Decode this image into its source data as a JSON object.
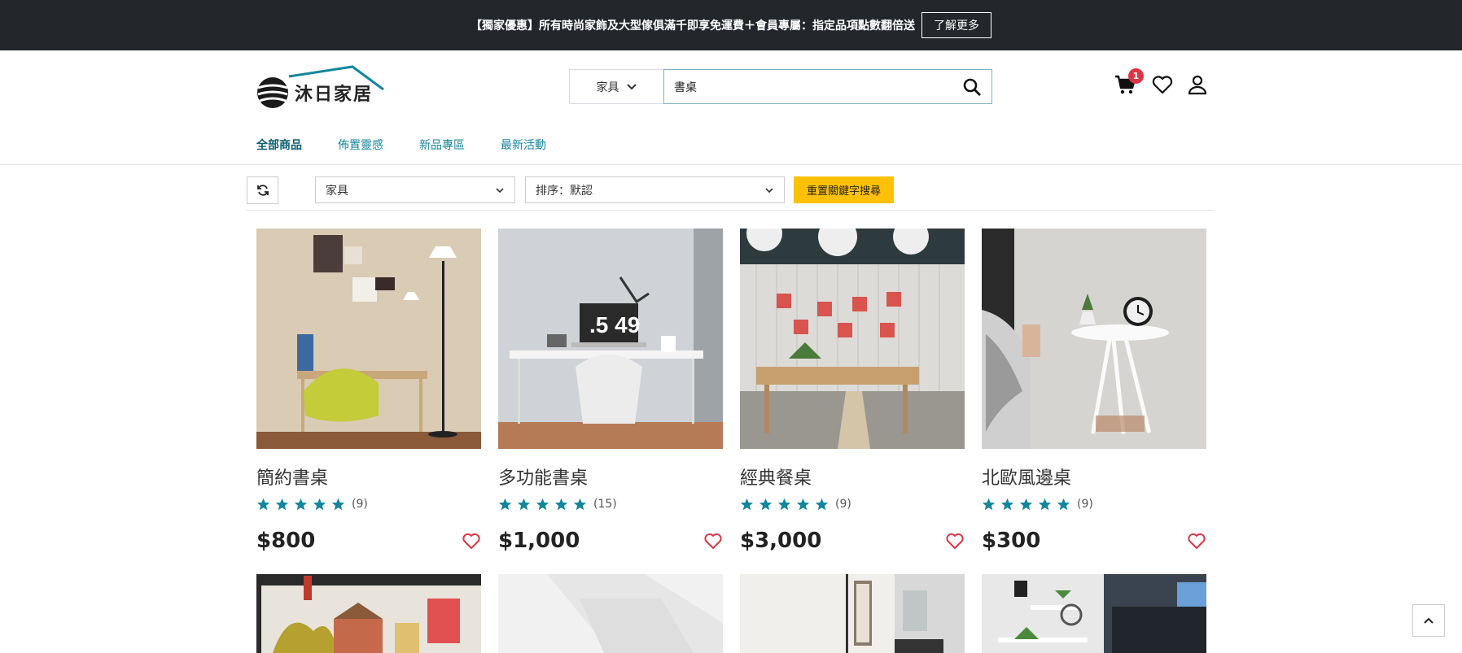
{
  "promo": {
    "text": "【獨家優惠】所有時尚家飾及大型傢俱滿千即享免運費＋會員專屬：指定品項點數翻倍送",
    "button": "了解更多"
  },
  "brand": {
    "name": "沐日家居"
  },
  "search": {
    "category": "家具",
    "value": "書桌"
  },
  "cart": {
    "badge": "1"
  },
  "nav": {
    "items": [
      {
        "label": "全部商品"
      },
      {
        "label": "佈置靈感"
      },
      {
        "label": "新品專區"
      },
      {
        "label": "最新活動"
      }
    ]
  },
  "filters": {
    "category": "家具",
    "sort": "排序：默認",
    "reset": "重置關鍵字搜尋"
  },
  "products": [
    {
      "title": "簡約書桌",
      "rating": 5,
      "count": "(9)",
      "price": "$800"
    },
    {
      "title": "多功能書桌",
      "rating": 5,
      "count": "(15)",
      "price": "$1,000"
    },
    {
      "title": "經典餐桌",
      "rating": 5,
      "count": "(9)",
      "price": "$3,000"
    },
    {
      "title": "北歐風邊桌",
      "rating": 5,
      "count": "(9)",
      "price": "$300"
    }
  ],
  "colors": {
    "accent": "#17869e",
    "star": "#13869e",
    "heart": "#dc3545",
    "promo_bg": "#23272b",
    "reset_btn": "#ffc107"
  },
  "icons": {
    "search": "search-icon",
    "cart": "cart-icon",
    "wishlist": "heart-icon",
    "account": "user-icon",
    "refresh": "refresh-icon",
    "back_to_top": "chevron-up-icon"
  }
}
